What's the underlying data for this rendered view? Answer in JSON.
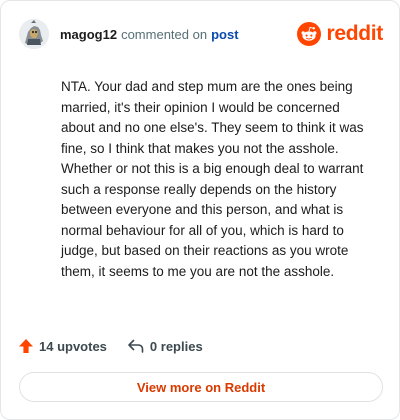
{
  "comment": {
    "username": "magog12",
    "action_text": "commented on",
    "post_link_text": "post",
    "body": "NTA. Your dad and step mum are the ones being married, it's their opinion I would be concerned about and no one else's. They seem to think it was fine, so I think that makes you not the asshole. Whether or not this is a big enough deal to warrant such a response really depends on the history between everyone and this person, and what is normal behaviour for all of you, which is hard to judge, but based on their reactions as you wrote them, it seems to me you are not the asshole."
  },
  "brand": {
    "wordmark": "reddit",
    "icon": "reddit-logo-icon",
    "color": "#ff4500"
  },
  "stats": {
    "upvotes_label": "14 upvotes",
    "upvote_icon": "upvote-arrow-icon",
    "replies_label": "0 replies",
    "reply_icon": "reply-arrow-icon"
  },
  "cta": {
    "view_more_label": "View more on Reddit",
    "color": "#d93a00"
  },
  "colors": {
    "link": "#0a4bab",
    "muted": "#576f76",
    "border": "#e4e6e8"
  }
}
